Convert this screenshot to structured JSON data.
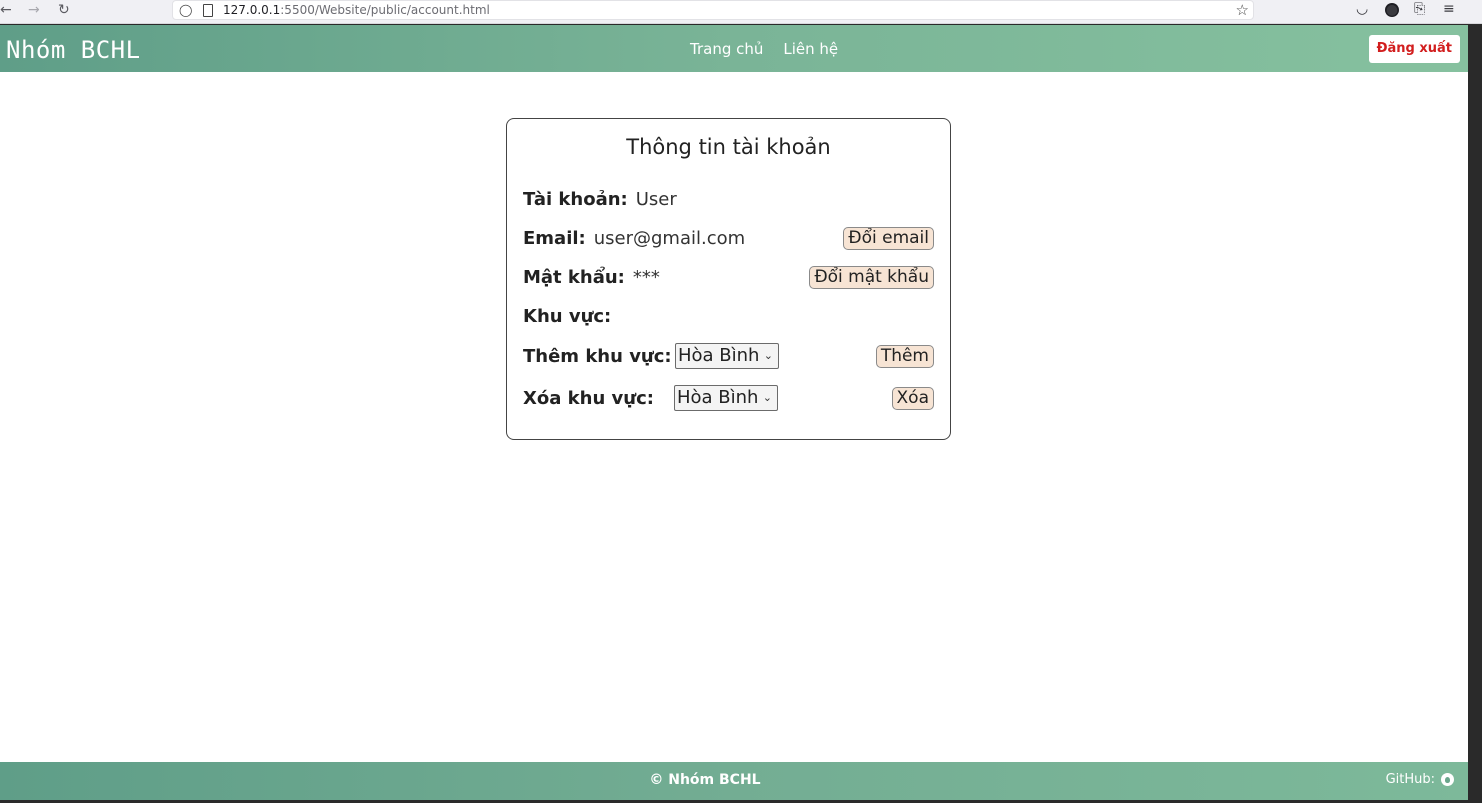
{
  "browser": {
    "url_host": "127.0.0.1",
    "url_rest": ":5500/Website/public/account.html",
    "icons": [
      "back-icon",
      "forward-icon",
      "reload-icon",
      "shield-icon",
      "page-icon",
      "star-icon",
      "pocket-icon",
      "account-icon",
      "extensions-icon",
      "menu-icon"
    ]
  },
  "header": {
    "brand": "Nhóm BCHL",
    "nav": [
      "Trang chủ",
      "Liên hệ"
    ],
    "logout": "Đăng xuất"
  },
  "card": {
    "title": "Thông tin tài khoản",
    "account_label": "Tài khoản:",
    "account_value": "User",
    "email_label": "Email:",
    "email_value": "user@gmail.com",
    "email_button": "Đổi email",
    "password_label": "Mật khẩu:",
    "password_value": "***",
    "password_button": "Đổi mật khẩu",
    "region_label": "Khu vực:",
    "add_region_label": "Thêm khu vực:",
    "add_region_selected": "Hòa Bình",
    "add_button": "Thêm",
    "remove_region_label": "Xóa khu vực:",
    "remove_region_selected": "Hòa Bình",
    "remove_button": "Xóa"
  },
  "footer": {
    "copyright": "© Nhóm BCHL",
    "github_label": "GitHub:"
  },
  "colors": {
    "header_start": "#5f9e88",
    "header_end": "#86c19f",
    "logout_text": "#d21e1e",
    "button_bg": "#f7e4d4"
  }
}
